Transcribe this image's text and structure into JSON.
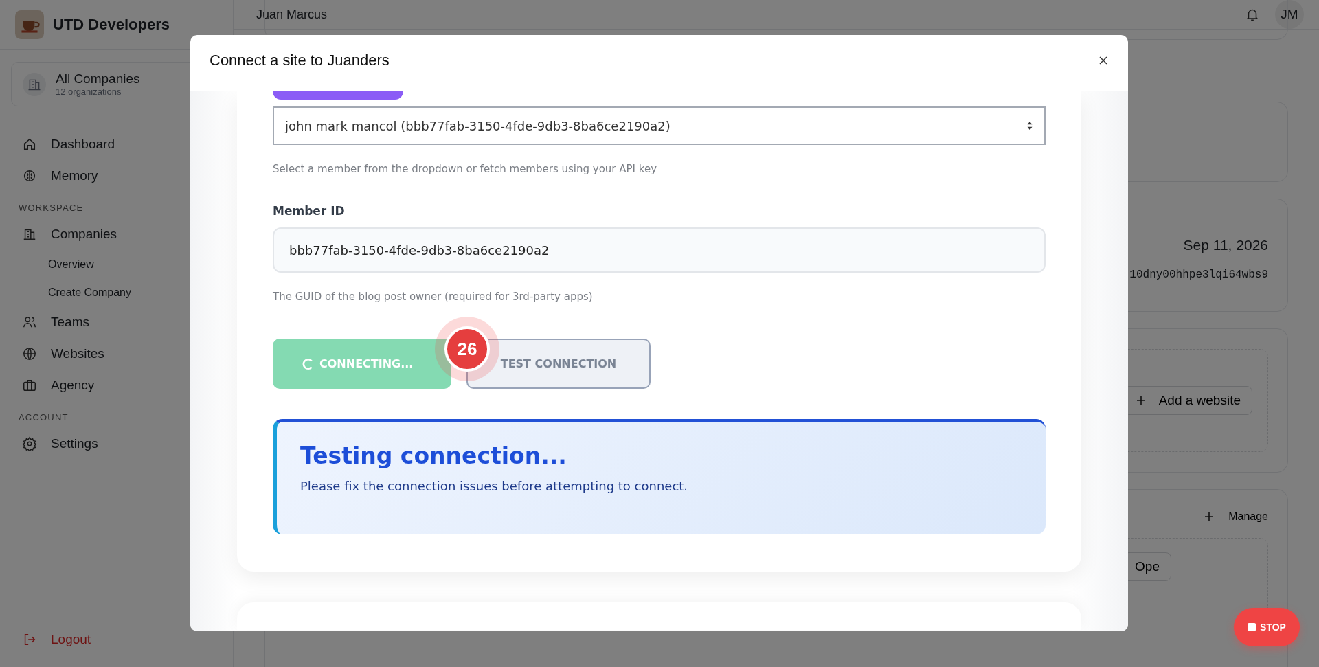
{
  "sidebar": {
    "brand": "UTD Developers",
    "company": {
      "name": "All Companies",
      "count": "12 organizations"
    },
    "nav": [
      {
        "label": "Dashboard"
      },
      {
        "label": "Memory"
      }
    ],
    "sections": [
      {
        "heading": "WORKSPACE",
        "items": [
          {
            "label": "Companies",
            "children": [
              {
                "label": "Overview"
              },
              {
                "label": "Create Company"
              }
            ]
          },
          {
            "label": "Teams"
          },
          {
            "label": "Websites"
          },
          {
            "label": "Agency"
          }
        ]
      },
      {
        "heading": "ACCOUNT",
        "items": [
          {
            "label": "Settings"
          }
        ]
      }
    ],
    "logout": "Logout"
  },
  "header": {
    "user": "Juan Marcus",
    "avatar": "JM"
  },
  "background": {
    "date": "Sep 11, 2026",
    "key": "10dny00hhpe3lqi64wbs9",
    "add_button": "Add a website",
    "manage": "Manage",
    "open_button": "Ope"
  },
  "modal": {
    "title": "Connect a site to Juanders",
    "member_select": {
      "value": "john mark mancol (bbb77fab-3150-4fde-9db3-8ba6ce2190a2)",
      "help": "Select a member from the dropdown or fetch members using your API key"
    },
    "member_id": {
      "label": "Member ID",
      "value": "bbb77fab-3150-4fde-9db3-8ba6ce2190a2",
      "help": "The GUID of the blog post owner (required for 3rd-party apps)"
    },
    "buttons": [
      {
        "kind": "connecting",
        "label": "CONNECTING...",
        "disabled": true
      },
      {
        "kind": "test",
        "label": "TEST CONNECTION",
        "disabled": false
      }
    ],
    "alert": {
      "title": "Testing connection...",
      "message": "Please fix the connection issues before attempting to connect."
    }
  },
  "step_badge": "26",
  "stop_button": "STOP"
}
